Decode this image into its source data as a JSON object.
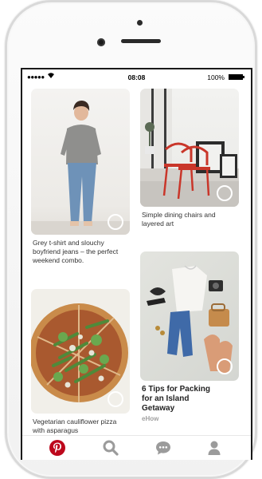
{
  "status_bar": {
    "signal": "●●●●●",
    "time": "08:08",
    "battery": "100%"
  },
  "pins": [
    {
      "caption": "Grey t-shirt and slouchy boyfriend jeans – the perfect weekend combo."
    },
    {
      "caption": "Simple dining chairs and layered art"
    },
    {
      "caption": "Vegetarian cauliflower pizza with asparagus"
    },
    {
      "caption": "6 Tips for Packing for an Island Getaway",
      "source": "eHow"
    }
  ],
  "tabs": [
    {
      "icon": "pinterest-logo-icon"
    },
    {
      "icon": "search-icon"
    },
    {
      "icon": "chat-bubble-icon"
    },
    {
      "icon": "profile-icon"
    }
  ],
  "colors": {
    "brand": "#bd081c",
    "icon_grey": "#9b9b9b"
  }
}
